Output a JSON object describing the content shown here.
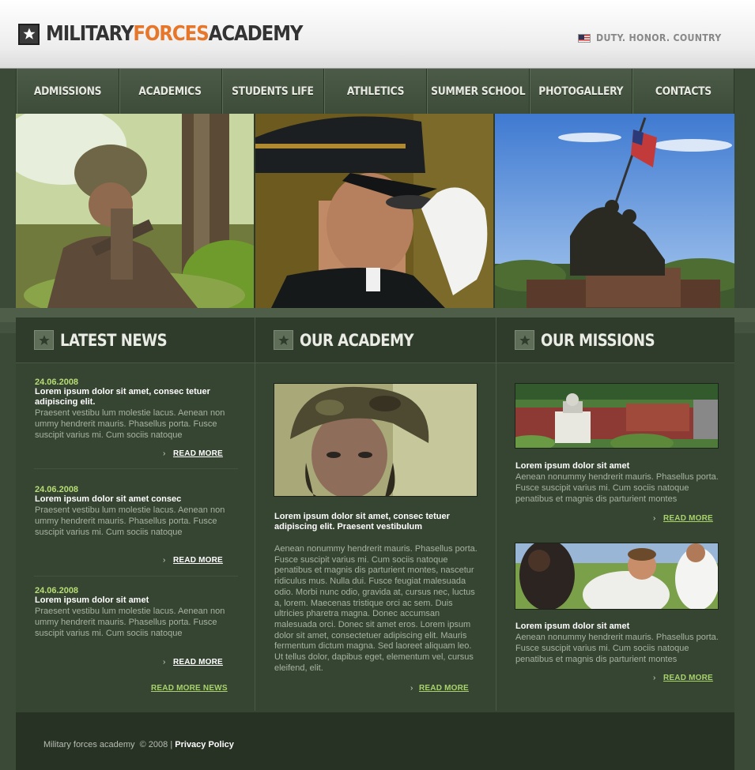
{
  "header": {
    "logo": {
      "part1": "MILITARY",
      "part2": "FORCES",
      "part3": "ACADEMY"
    },
    "motto": "DUTY. HONOR. COUNTRY"
  },
  "nav": {
    "items": [
      "ADMISSIONS",
      "ACADEMICS",
      "STUDENTS LIFE",
      "ATHLETICS",
      "SUMMER SCHOOL",
      "PHOTOGALLERY",
      "CONTACTS"
    ]
  },
  "latest_news": {
    "title": "LATEST NEWS",
    "items": [
      {
        "date": "24.06.2008",
        "headline": "Lorem ipsum dolor sit amet, consec tetuer adipiscing elit.",
        "body": "Praesent vestibu lum molestie lacus. Aenean non ummy hendrerit mauris. Phasellus porta. Fusce suscipit varius mi. Cum sociis natoque",
        "read_more": "READ MORE"
      },
      {
        "date": "24.06.2008",
        "headline": "Lorem ipsum dolor sit amet consec",
        "body": "Praesent vestibu lum molestie lacus. Aenean non ummy hendrerit mauris. Phasellus porta. Fusce suscipit varius mi. Cum sociis natoque",
        "read_more": "READ MORE"
      },
      {
        "date": "24.06.2008",
        "headline": "Lorem ipsum dolor sit amet",
        "body": "Praesent vestibu lum molestie lacus. Aenean non ummy hendrerit mauris. Phasellus porta. Fusce suscipit varius mi. Cum sociis natoque",
        "read_more": "READ MORE"
      }
    ],
    "more_news": "READ MORE NEWS"
  },
  "our_academy": {
    "title": "OUR ACADEMY",
    "headline": "Lorem ipsum dolor sit amet, consec tetuer adipiscing elit. Praesent vestibulum",
    "body": "Aenean nonummy hendrerit mauris. Phasellus porta. Fusce suscipit varius mi. Cum sociis natoque penatibus et magnis dis parturient montes, nascetur ridiculus mus. Nulla dui. Fusce feugiat malesuada odio. Morbi nunc odio, gravida at, cursus nec, luctus a, lorem. Maecenas tristique orci ac sem. Duis ultricies pharetra magna. Donec accumsan malesuada orci. Donec sit amet eros. Lorem ipsum dolor sit amet, consectetuer adipiscing elit. Mauris fermentum dictum magna. Sed laoreet aliquam leo. Ut tellus dolor, dapibus eget, elementum vel, cursus eleifend, elit.",
    "read_more": "READ MORE"
  },
  "our_missions": {
    "title": "OUR MISSIONS",
    "items": [
      {
        "headline": "Lorem ipsum dolor sit amet",
        "body": "Aenean nonummy hendrerit mauris. Phasellus porta. Fusce suscipit varius mi. Cum sociis natoque penatibus et magnis dis parturient montes",
        "read_more": "READ MORE"
      },
      {
        "headline": "Lorem ipsum dolor sit amet",
        "body": "Aenean nonummy hendrerit mauris. Phasellus porta. Fusce suscipit varius mi. Cum sociis natoque penatibus et magnis dis parturient montes",
        "read_more": "READ MORE"
      }
    ]
  },
  "footer": {
    "copyright": "Military forces academy  © 2008 |",
    "privacy": "Privacy Policy"
  },
  "colors": {
    "accent_orange": "#e6762a",
    "date_green": "#b7dd74",
    "link_green": "#a9d36b",
    "panel": "#364432"
  }
}
